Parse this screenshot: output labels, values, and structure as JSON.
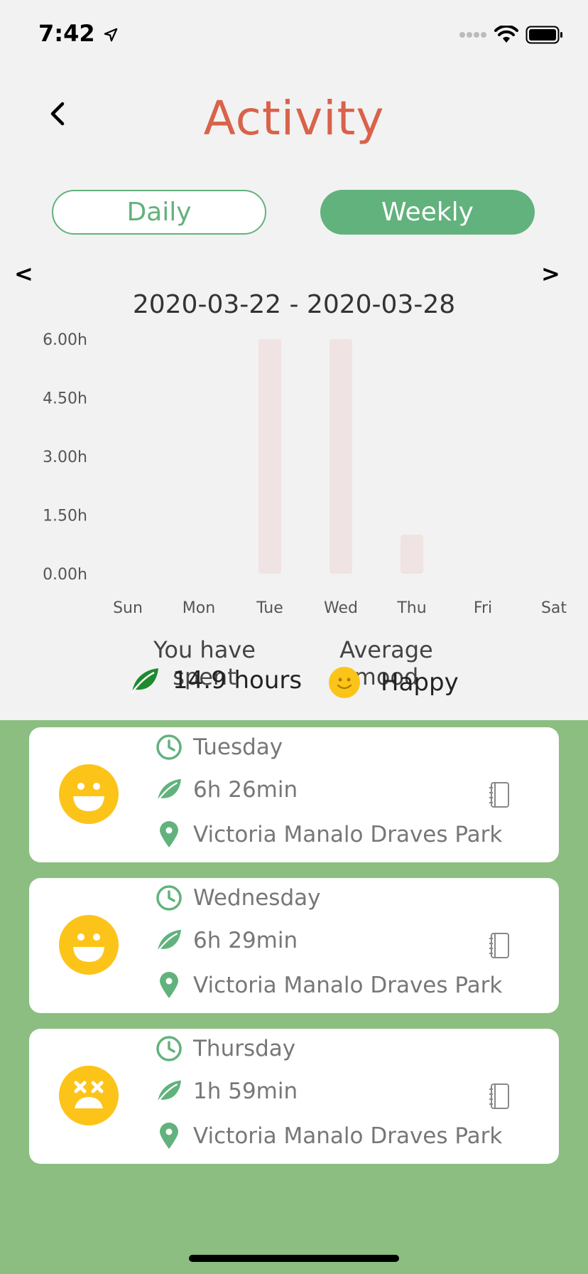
{
  "status_bar": {
    "time": "7:42"
  },
  "header": {
    "title": "Activity"
  },
  "toggle": {
    "daily_label": "Daily",
    "weekly_label": "Weekly",
    "selected": "Weekly"
  },
  "week_nav": {
    "prev_label": "<",
    "next_label": ">",
    "date_range": "2020-03-22 - 2020-03-28"
  },
  "chart_data": {
    "type": "bar",
    "categories": [
      "Sun",
      "Mon",
      "Tue",
      "Wed",
      "Thu",
      "Fri",
      "Sat"
    ],
    "values": [
      0,
      0,
      6.0,
      6.0,
      1.0,
      0,
      0
    ],
    "y_ticks": [
      "0.00h",
      "1.50h",
      "3.00h",
      "4.50h",
      "6.00h"
    ],
    "y_tick_values": [
      0,
      1.5,
      3.0,
      4.5,
      6.0
    ],
    "ylim": [
      0,
      6.0
    ],
    "bar_color": "#efe4e3",
    "grid": false
  },
  "summary": {
    "spent_label": "You have spent",
    "spent_value": "14.9 hours",
    "mood_label": "Average mood",
    "mood_value": "Happy"
  },
  "activities": [
    {
      "day": "Tuesday",
      "duration": "6h 26min",
      "location": "Victoria Manalo Draves Park",
      "mood_icon": "happy-face-icon"
    },
    {
      "day": "Wednesday",
      "duration": "6h 29min",
      "location": "Victoria Manalo Draves Park",
      "mood_icon": "happy-face-icon"
    },
    {
      "day": "Thursday",
      "duration": "1h 59min",
      "location": "Victoria Manalo Draves Park",
      "mood_icon": "dizzy-face-icon"
    }
  ],
  "colors": {
    "accent": "#62b27d",
    "title": "#d9624a",
    "list_bg": "#8bbe80",
    "mood": "#fcc419"
  }
}
